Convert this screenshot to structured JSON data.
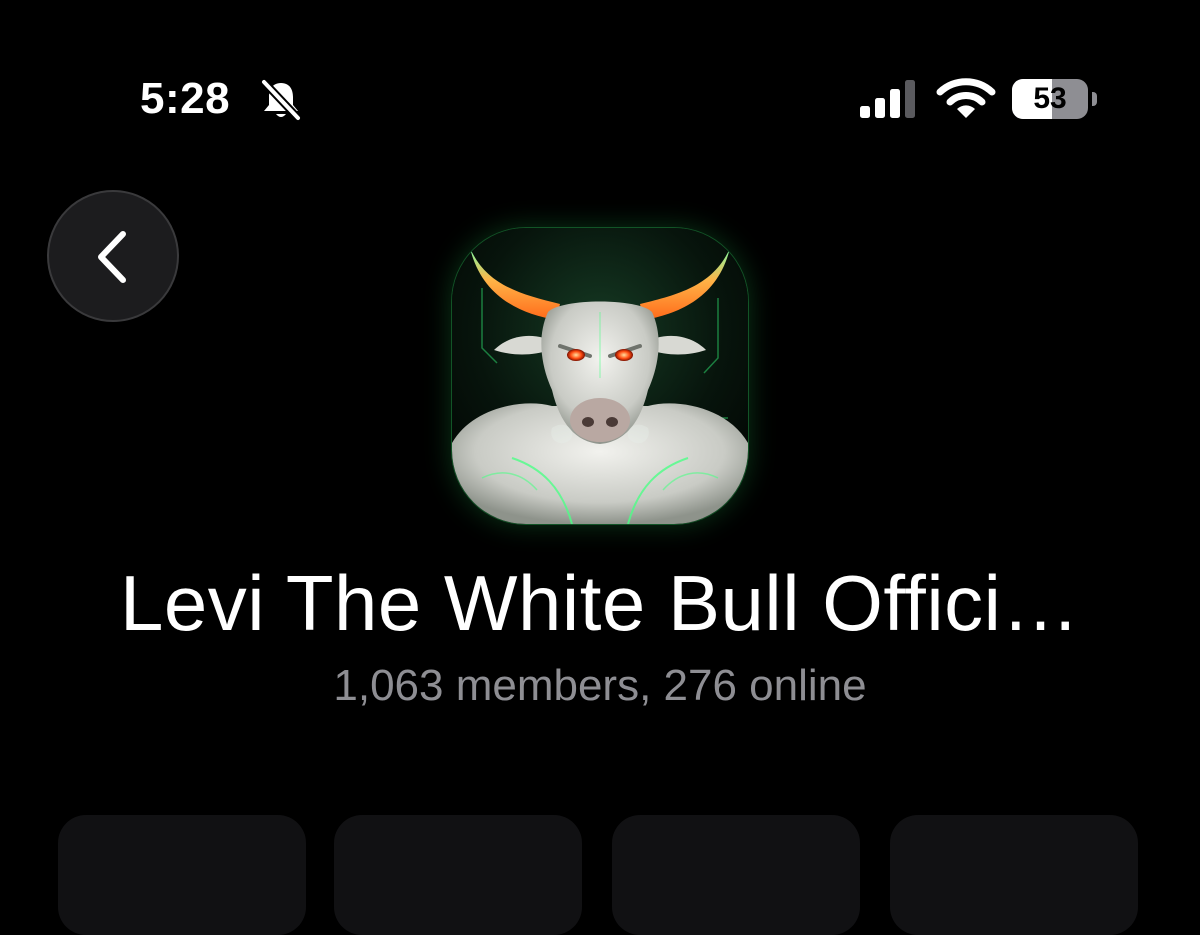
{
  "status_bar": {
    "time": "5:28",
    "bell_icon": "bell-slash-icon",
    "signal_icon": "cellular-signal-icon",
    "wifi_icon": "wifi-icon",
    "battery_level": "53",
    "battery_fraction": 0.53
  },
  "nav": {
    "back_icon": "chevron-left-icon"
  },
  "group": {
    "avatar_icon": "white-bull-avatar",
    "name": "Levi The White Bull Offici…",
    "meta": "1,063 members, 276 online"
  },
  "colors": {
    "background": "#000000",
    "secondary_text": "#8e8e93",
    "button_bg": "#1c1c1e",
    "accent_glow": "#3cff78"
  }
}
